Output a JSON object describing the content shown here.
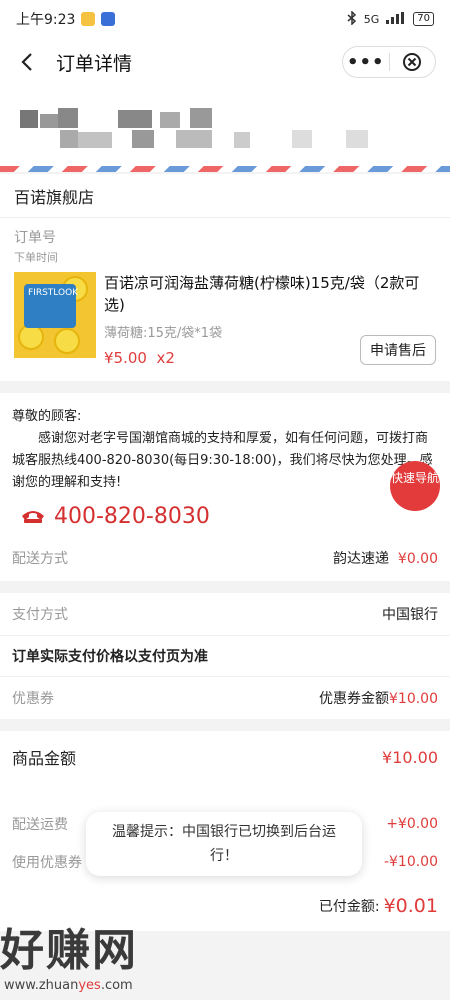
{
  "status_bar": {
    "time": "上午9:23",
    "network": "5G",
    "battery": "70"
  },
  "navbar": {
    "title": "订单详情",
    "more_label": "•••"
  },
  "shop": {
    "name": "百诺旗舰店"
  },
  "order": {
    "number_label": "订单号",
    "time_label": "下单时间"
  },
  "product": {
    "title": "百诺凉可润海盐薄荷糖(柠檬味)15克/袋（2款可选)",
    "spec": "薄荷糖:15克/袋*1袋",
    "price": "¥5.00",
    "qty": "x2",
    "after_sale_button": "申请售后",
    "thumb_text": "FIRSTLOOK"
  },
  "notice": {
    "greeting": "尊敬的顾客:",
    "body": "感谢您对老字号国潮馆商城的支持和厚爱，如有任何问题，可拨打商城客服热线400-820-8030(每日9:30-18:00)，我们将尽快为您处理。感谢您的理解和支持!",
    "hotline": "400-820-8030",
    "fab": "快速导航"
  },
  "delivery": {
    "label": "配送方式",
    "carrier": "韵达速递",
    "fee": "¥0.00"
  },
  "payment": {
    "label": "支付方式",
    "value": "中国银行",
    "note": "订单实际支付价格以支付页为准"
  },
  "coupon": {
    "label": "优惠券",
    "value_prefix": "优惠券金额",
    "value": "¥10.00"
  },
  "summary": {
    "goods_label": "商品金额",
    "goods_value": "¥10.00",
    "shipping_label": "配送运费",
    "shipping_value": "+¥0.00",
    "coupon_label": "使用优惠券",
    "coupon_value": "-¥10.00",
    "paid_label": "已付金额:",
    "paid_value": "¥0.01"
  },
  "toast": {
    "text": "温馨提示：中国银行已切换到后台运行！"
  },
  "watermark": {
    "main": "好赚网",
    "url_pre": "www.zhuan",
    "url_mid": "yes",
    "url_post": ".com"
  },
  "colors": {
    "accent": "#e03c3c",
    "background": "#f3f3f3"
  }
}
